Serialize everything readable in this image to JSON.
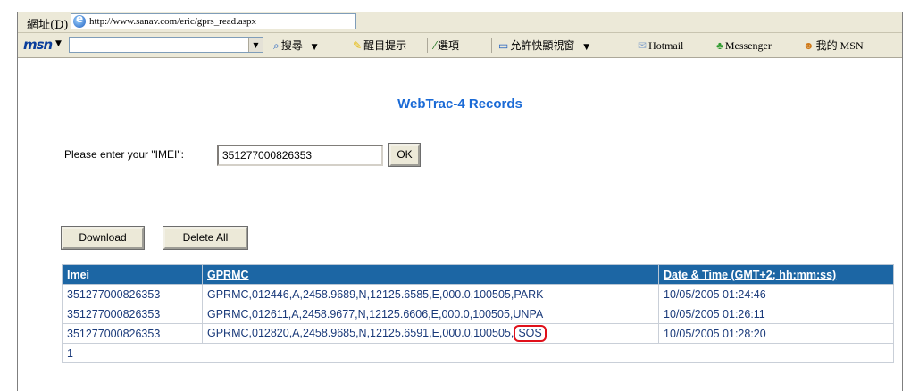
{
  "browser": {
    "address_label": "網址(D)",
    "url": "http://www.sanav.com/eric/gprs_read.aspx"
  },
  "msn_toolbar": {
    "logo": "msn",
    "search_value": "",
    "items": [
      "搜尋",
      "醒目提示",
      "選項",
      "允許快顯視窗",
      "Hotmail",
      "Messenger",
      "我的 MSN"
    ]
  },
  "page": {
    "title": "WebTrac-4 Records",
    "imei_label": "Please enter your \"IMEI\":",
    "imei_value": "351277000826353",
    "ok_label": "OK",
    "download_label": "Download",
    "delete_all_label": "Delete All"
  },
  "table": {
    "headers": [
      "Imei",
      "GPRMC",
      "Date & Time (GMT+2; hh:mm:ss)"
    ],
    "rows": [
      {
        "imei": "351277000826353",
        "gprmc": "GPRMC,012446,A,2458.9689,N,12125.6585,E,000.0,100505,PARK",
        "datetime": "10/05/2005 01:24:46"
      },
      {
        "imei": "351277000826353",
        "gprmc": "GPRMC,012611,A,2458.9677,N,12125.6606,E,000.0,100505,UNPA",
        "datetime": "10/05/2005 01:26:11"
      },
      {
        "imei": "351277000826353",
        "gprmc_prefix": "GPRMC,012820,A,2458.9685,N,12125.6591,E,000.0,100505,",
        "gprmc_highlight": "SOS",
        "datetime": "10/05/2005 01:28:20"
      }
    ],
    "pager": "1"
  },
  "colors": {
    "header_bg": "#1c66a4",
    "title_blue": "#1a6ad6",
    "highlight_red": "#e0101a"
  }
}
